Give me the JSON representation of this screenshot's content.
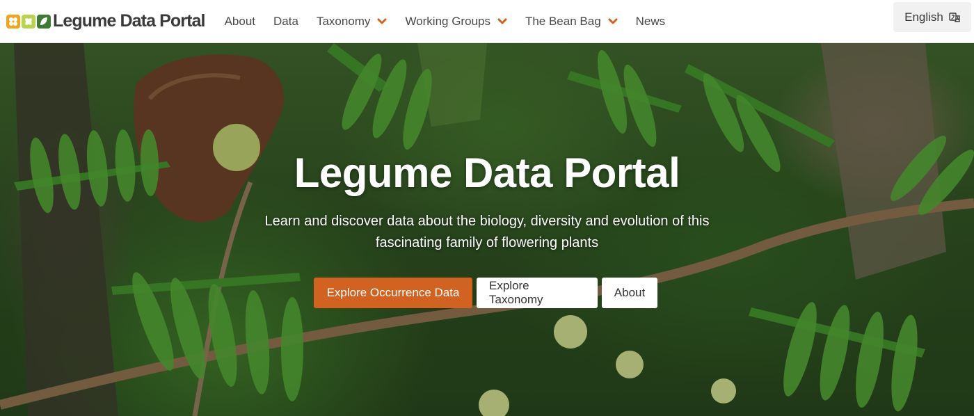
{
  "brand": {
    "text_main": "Legume ",
    "text_accent": "Data Portal",
    "icon": "legume-logo-icon"
  },
  "nav": {
    "items": [
      {
        "label": "About",
        "has_dropdown": false
      },
      {
        "label": "Data",
        "has_dropdown": false
      },
      {
        "label": "Taxonomy",
        "has_dropdown": true
      },
      {
        "label": "Working Groups",
        "has_dropdown": true
      },
      {
        "label": "The Bean Bag",
        "has_dropdown": true
      },
      {
        "label": "News",
        "has_dropdown": false
      }
    ],
    "dropdown_icon": "chevron-down-icon",
    "dropdown_color": "#d2621f"
  },
  "language": {
    "label": "English",
    "icon": "translate-icon"
  },
  "hero": {
    "title": "Legume Data Portal",
    "subtitle": "Learn and discover data about the biology, diversity and evolution of this fascinating family of flowering plants",
    "buttons": {
      "occurrence": "Explore Occurrence Data",
      "taxonomy": "Explore Taxonomy",
      "about": "About"
    }
  },
  "colors": {
    "accent": "#d2621f",
    "brand_green": "#3d7a34",
    "text": "#4a4a4a"
  }
}
